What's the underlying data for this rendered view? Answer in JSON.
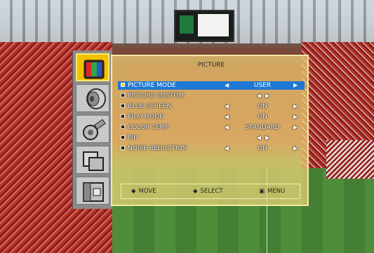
{
  "menu": {
    "title": "PICTURE",
    "items": [
      {
        "label": "PICTURE MODE",
        "value": "USER",
        "selected": true
      },
      {
        "label": "PICTURE CUSTOM",
        "value": ""
      },
      {
        "label": "BLUE SCREEN",
        "value": "ON"
      },
      {
        "label": "FILM MODE",
        "value": "ON"
      },
      {
        "label": "COLOR TEMP",
        "value": "STANDARD"
      },
      {
        "label": "PIP",
        "value": ""
      },
      {
        "label": "NOISE REDUCTION",
        "value": "ON"
      }
    ],
    "arrow_left": "◀",
    "arrow_right": "▶"
  },
  "footer": {
    "move_icon": "◆",
    "move": "MOVE",
    "select_icon": "◆",
    "select": "SELECT",
    "menu_icon": "▣",
    "menu": "MENU"
  },
  "sidebar": {
    "icons": [
      "picture-icon",
      "sound-icon",
      "setup-icon",
      "pip-icon",
      "input-icon"
    ]
  },
  "colors": {
    "panel": "#ebd678",
    "highlight": "#1e78d4",
    "active_tab": "#f2c200"
  }
}
